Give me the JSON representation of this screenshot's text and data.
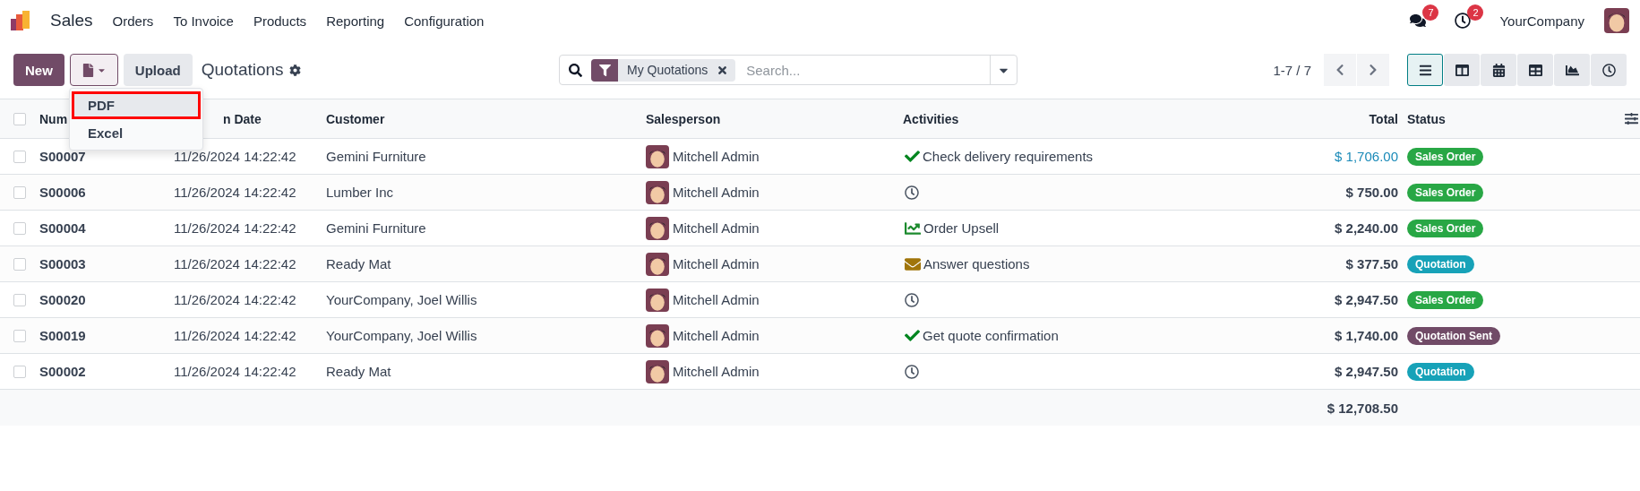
{
  "navbar": {
    "app": "Sales",
    "menu": [
      "Orders",
      "To Invoice",
      "Products",
      "Reporting",
      "Configuration"
    ],
    "messages_badge": "7",
    "activities_badge": "2",
    "company": "YourCompany"
  },
  "control_panel": {
    "new_button": "New",
    "upload_button": "Upload",
    "title": "Quotations",
    "export_menu": {
      "expanded": true,
      "items": [
        {
          "label": "PDF",
          "highlighted": true
        },
        {
          "label": "Excel",
          "highlighted": false
        }
      ]
    },
    "search": {
      "facet": "My Quotations",
      "placeholder": "Search..."
    },
    "pager": "1-7 / 7",
    "views": [
      {
        "kind": "list",
        "selected": true
      },
      {
        "kind": "kanban",
        "selected": false
      },
      {
        "kind": "calendar",
        "selected": false
      },
      {
        "kind": "pivot",
        "selected": false
      },
      {
        "kind": "graph",
        "selected": false
      },
      {
        "kind": "activity",
        "selected": false
      }
    ]
  },
  "table": {
    "select_all_checked": false,
    "columns": [
      "Num",
      "n Date",
      "Customer",
      "Salesperson",
      "Activities",
      "Total",
      "Status"
    ],
    "rows": [
      {
        "checked": false,
        "number": "S00007",
        "date": "11/26/2024 14:22:42",
        "customer": "Gemini Furniture",
        "salesperson": "Mitchell Admin",
        "activity": {
          "kind": "done",
          "text": "Check delivery requirements"
        },
        "total": "$ 1,706.00",
        "total_highlighted": true,
        "status": {
          "label": "Sales Order",
          "color": "#28a745"
        }
      },
      {
        "checked": false,
        "number": "S00006",
        "date": "11/26/2024 14:22:42",
        "customer": "Lumber Inc",
        "salesperson": "Mitchell Admin",
        "activity": {
          "kind": "none"
        },
        "total": "$ 750.00",
        "total_highlighted": false,
        "status": {
          "label": "Sales Order",
          "color": "#28a745"
        }
      },
      {
        "checked": false,
        "number": "S00004",
        "date": "11/26/2024 14:22:42",
        "customer": "Gemini Furniture",
        "salesperson": "Mitchell Admin",
        "activity": {
          "kind": "upsell",
          "text": "Order Upsell"
        },
        "total": "$ 2,240.00",
        "total_highlighted": false,
        "status": {
          "label": "Sales Order",
          "color": "#28a745"
        }
      },
      {
        "checked": false,
        "number": "S00003",
        "date": "11/26/2024 14:22:42",
        "customer": "Ready Mat",
        "salesperson": "Mitchell Admin",
        "activity": {
          "kind": "email",
          "text": "Answer questions"
        },
        "total": "$ 377.50",
        "total_highlighted": false,
        "status": {
          "label": "Quotation",
          "color": "#17a2b8"
        }
      },
      {
        "checked": false,
        "number": "S00020",
        "date": "11/26/2024 14:22:42",
        "customer": "YourCompany, Joel Willis",
        "salesperson": "Mitchell Admin",
        "activity": {
          "kind": "none"
        },
        "total": "$ 2,947.50",
        "total_highlighted": false,
        "status": {
          "label": "Sales Order",
          "color": "#28a745"
        }
      },
      {
        "checked": false,
        "number": "S00019",
        "date": "11/26/2024 14:22:42",
        "customer": "YourCompany, Joel Willis",
        "salesperson": "Mitchell Admin",
        "activity": {
          "kind": "done",
          "text": "Get quote confirmation"
        },
        "total": "$ 1,740.00",
        "total_highlighted": false,
        "status": {
          "label": "Quotation Sent",
          "color": "#714b67"
        }
      },
      {
        "checked": false,
        "number": "S00002",
        "date": "11/26/2024 14:22:42",
        "customer": "Ready Mat",
        "salesperson": "Mitchell Admin",
        "activity": {
          "kind": "none"
        },
        "total": "$ 2,947.50",
        "total_highlighted": false,
        "status": {
          "label": "Quotation",
          "color": "#17a2b8"
        }
      }
    ],
    "footer_total": "$ 12,708.50"
  }
}
